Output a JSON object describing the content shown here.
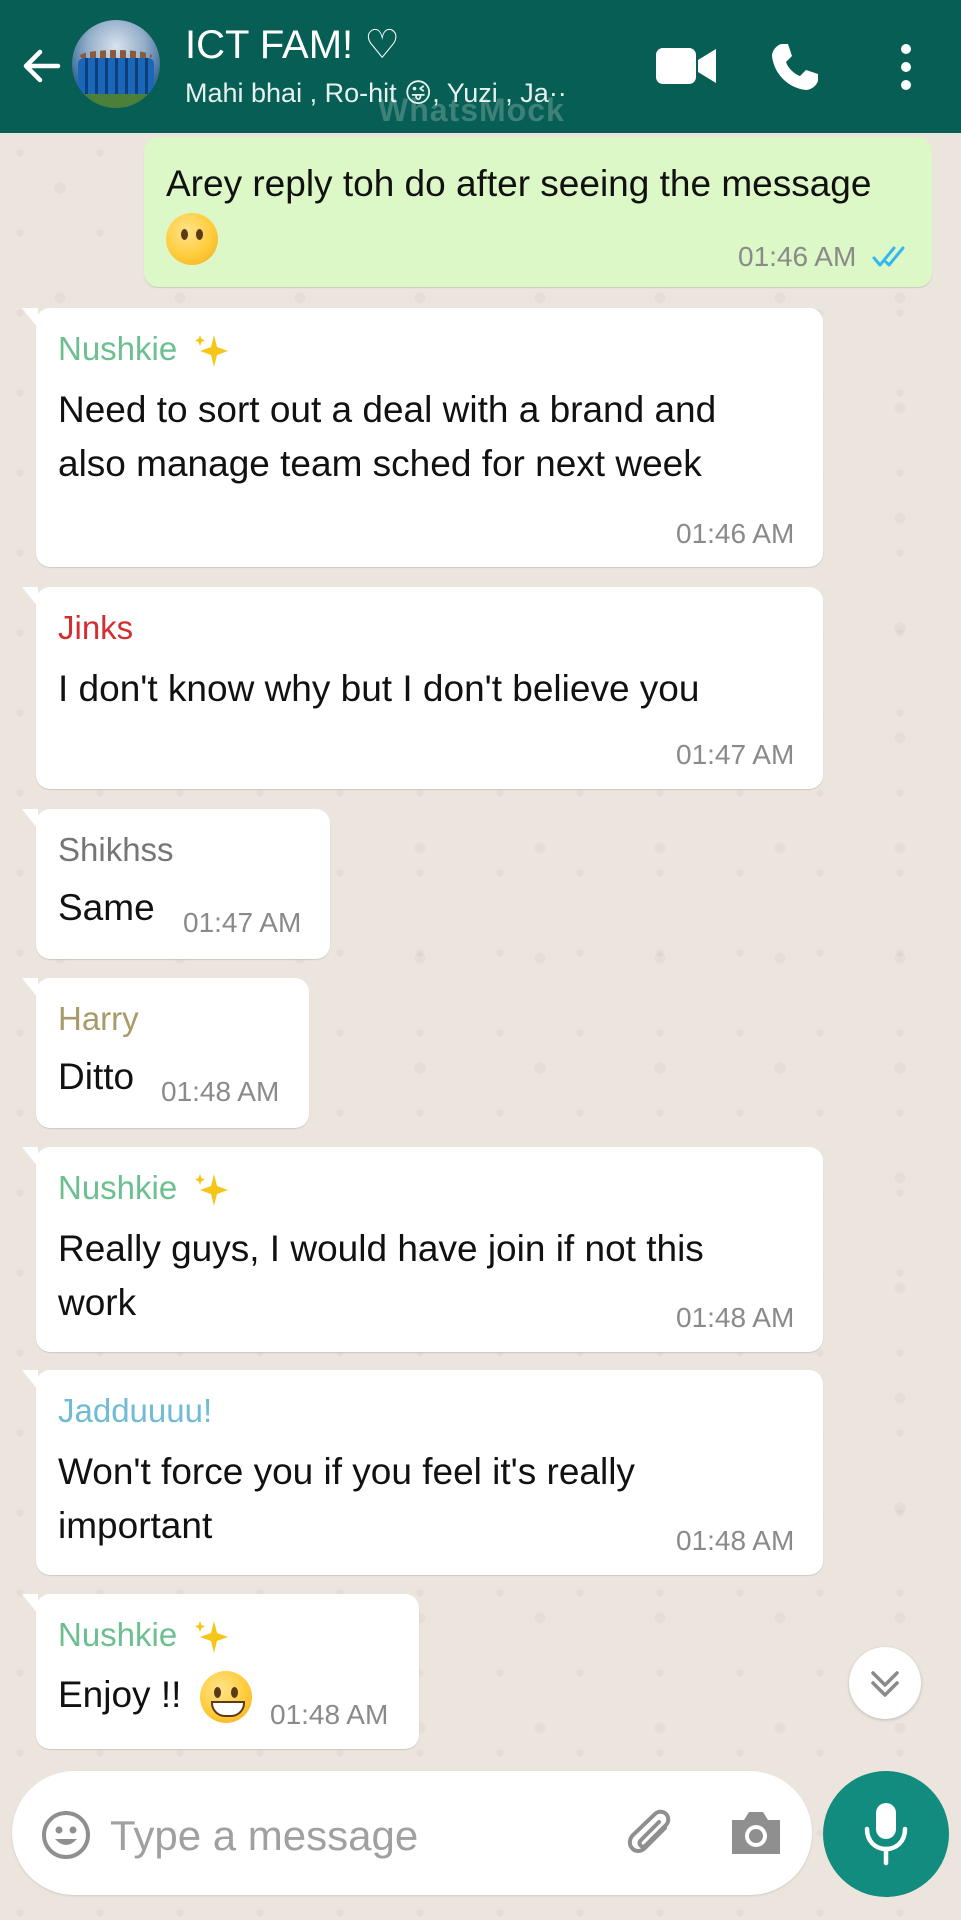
{
  "colors": {
    "header": "#075e54",
    "outgoing": "#dcf8c6",
    "incoming": "#ffffff",
    "accent": "#128c7e",
    "read_ticks": "#34b7f1"
  },
  "header": {
    "title": "ICT FAM! ♡",
    "members": "Mahi bhai , Ro-hit 😜, Yuzi , Ja··",
    "watermark": "WhatsMock",
    "icons": [
      "back-arrow-icon",
      "video-call-icon",
      "phone-icon",
      "more-vert-icon"
    ]
  },
  "messages": [
    {
      "direction": "out",
      "text_lines": [
        "Arey reply toh do after seeing the message"
      ],
      "emoji": "😶",
      "time": "01:46 AM",
      "status": "read"
    },
    {
      "direction": "in",
      "sender": "Nushkie",
      "sender_suffix": "✨",
      "sender_color": "#6cbf8f",
      "text_lines": [
        "Need to sort out a deal with a brand and",
        "also manage team sched for next week"
      ],
      "time": "01:46 AM"
    },
    {
      "direction": "in",
      "sender": "Jinks",
      "sender_color": "#d32f2f",
      "text_lines": [
        "I don't know why but I don't believe you"
      ],
      "time": "01:47 AM"
    },
    {
      "direction": "in",
      "sender": "Shikhss",
      "sender_color": "#757575",
      "text_lines": [
        "Same"
      ],
      "time": "01:47 AM"
    },
    {
      "direction": "in",
      "sender": "Harry",
      "sender_color": "#a89b6a",
      "text_lines": [
        "Ditto"
      ],
      "time": "01:48 AM"
    },
    {
      "direction": "in",
      "sender": "Nushkie",
      "sender_suffix": "✨",
      "sender_color": "#6cbf8f",
      "text_lines": [
        "Really guys, I would have join if not this",
        "work"
      ],
      "time": "01:48 AM"
    },
    {
      "direction": "in",
      "sender": "Jadduuuu!",
      "sender_color": "#6fbcd4",
      "text_lines": [
        "Won't force you if you feel it's really",
        "important"
      ],
      "time": "01:48 AM"
    },
    {
      "direction": "in",
      "sender": "Nushkie",
      "sender_suffix": "✨",
      "sender_color": "#6cbf8f",
      "text_lines": [
        "Enjoy !!"
      ],
      "emoji": "😁",
      "time": "01:48 AM"
    }
  ],
  "composer": {
    "placeholder": "Type a message",
    "icons": [
      "emoji-icon",
      "attach-icon",
      "camera-icon",
      "mic-icon"
    ]
  }
}
